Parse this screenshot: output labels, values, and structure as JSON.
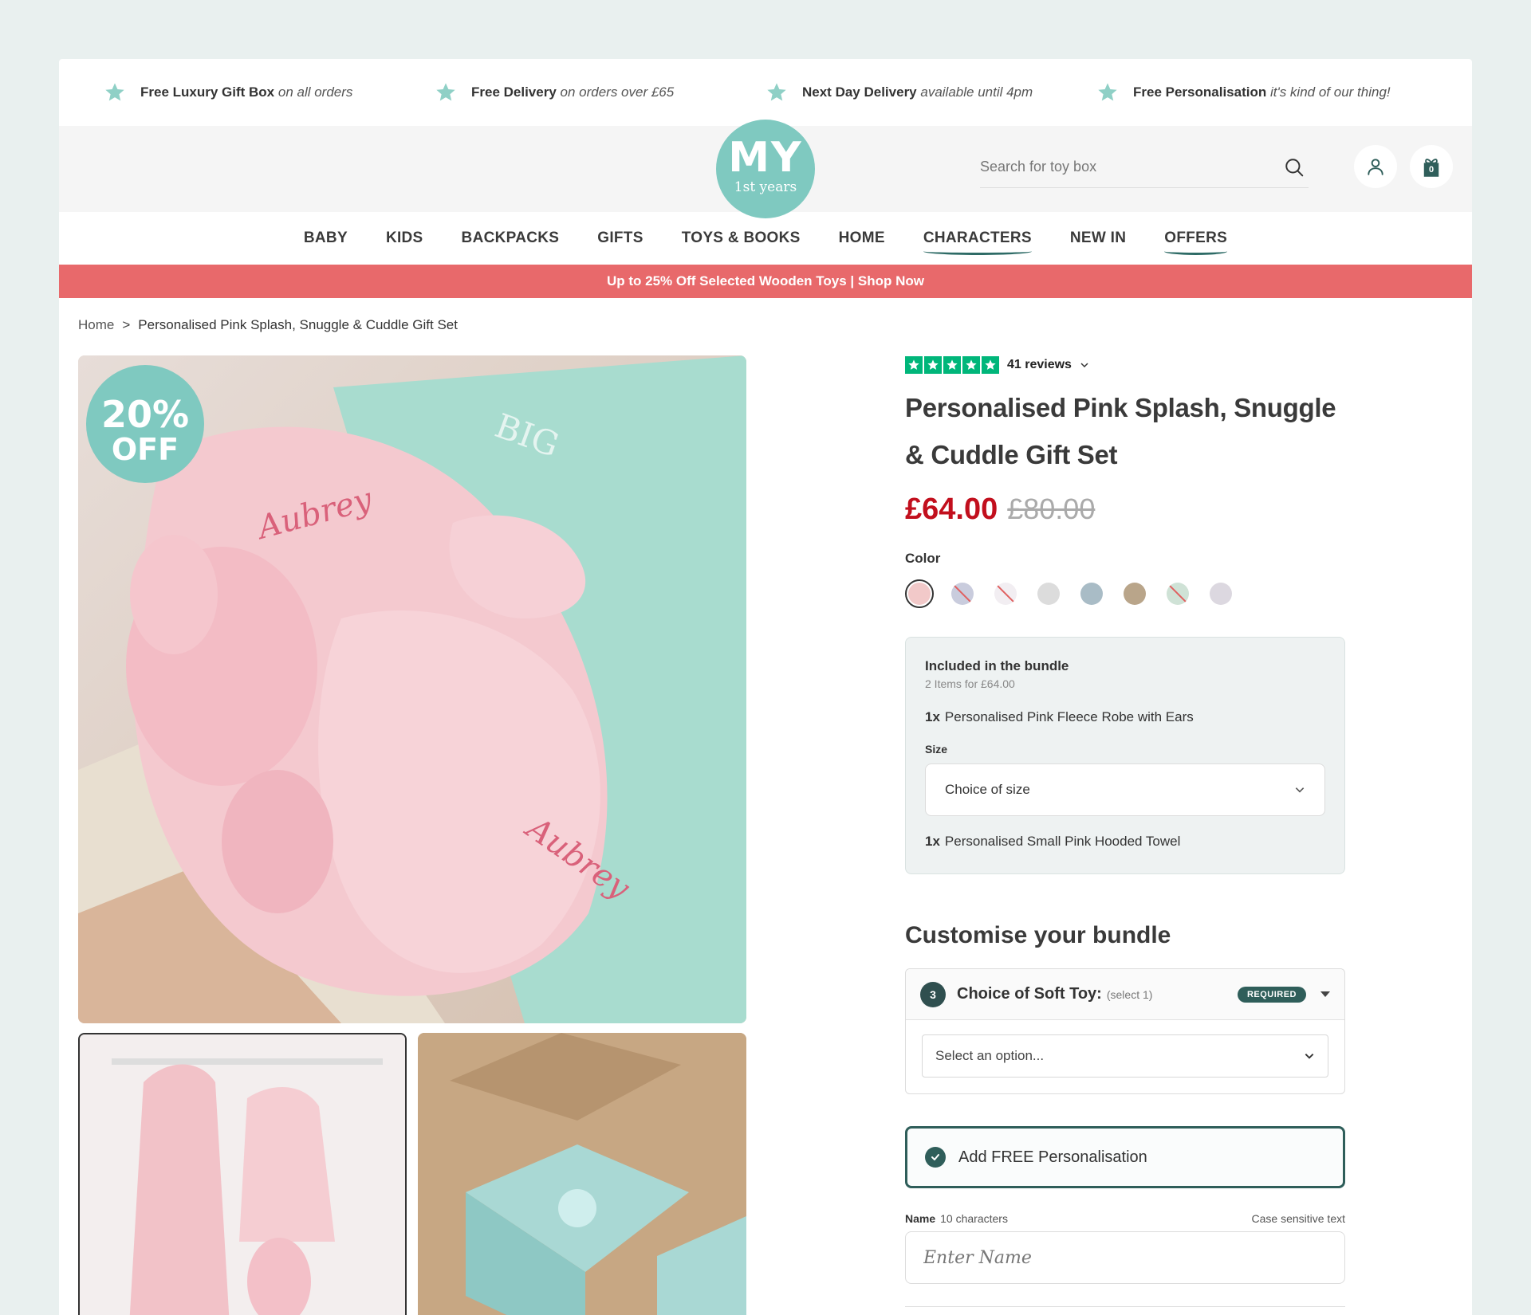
{
  "usp": [
    {
      "bold": "Free Luxury Gift Box",
      "rest": " on all orders"
    },
    {
      "bold": "Free Delivery",
      "rest": " on orders over £65"
    },
    {
      "bold": "Next Day Delivery",
      "rest": " available until 4pm"
    },
    {
      "bold": "Free Personalisation",
      "rest": " it's kind of our thing!"
    }
  ],
  "logo": {
    "main": "MY",
    "sub": "1st years"
  },
  "search": {
    "placeholder": "Search for toy box"
  },
  "cart": {
    "count": "0"
  },
  "nav": [
    "BABY",
    "KIDS",
    "BACKPACKS",
    "GIFTS",
    "TOYS & BOOKS",
    "HOME",
    "CHARACTERS",
    "NEW IN",
    "OFFERS"
  ],
  "promo": "Up to 25% Off Selected Wooden Toys | Shop Now",
  "breadcrumb": {
    "home": "Home",
    "separator": ">",
    "current": "Personalised Pink Splash, Snuggle & Cuddle Gift Set"
  },
  "gallery": {
    "badge_pct": "20%",
    "badge_off": "OFF"
  },
  "product": {
    "reviews": "41 reviews",
    "title": "Personalised Pink Splash, Snuggle & Cuddle Gift Set",
    "price_now": "£64.00",
    "price_was": "£80.00",
    "color_label": "Color",
    "swatches": [
      "#f2c9c9",
      "#c9ccdd",
      "#f2eef2",
      "#dcdcdc",
      "#a9bcc6",
      "#b9a58a",
      "#cfe2d6",
      "#dcd8e0"
    ]
  },
  "bundle": {
    "title": "Included in the bundle",
    "subtitle": "2 Items for £64.00",
    "item1_qty": "1x",
    "item1": "Personalised Pink Fleece Robe with Ears",
    "size_label": "Size",
    "size_value": "Choice of size",
    "item2_qty": "1x",
    "item2": "Personalised Small Pink Hooded Towel"
  },
  "customise": {
    "title": "Customise your bundle",
    "step": "3",
    "toy_label": "Choice of Soft Toy:",
    "toy_hint": "(select 1)",
    "required": "REQUIRED",
    "select_placeholder": "Select an option...",
    "personalisation": "Add FREE Personalisation",
    "name_label": "Name",
    "name_hint": "10 characters",
    "case_note": "Case sensitive text",
    "name_placeholder": "Enter Name"
  },
  "colors": {
    "accent": "#7fc9c0",
    "dark_teal": "#2f5e5a",
    "promo": "#e8696b",
    "price": "#c20f1d",
    "trustpilot": "#00b67a"
  }
}
